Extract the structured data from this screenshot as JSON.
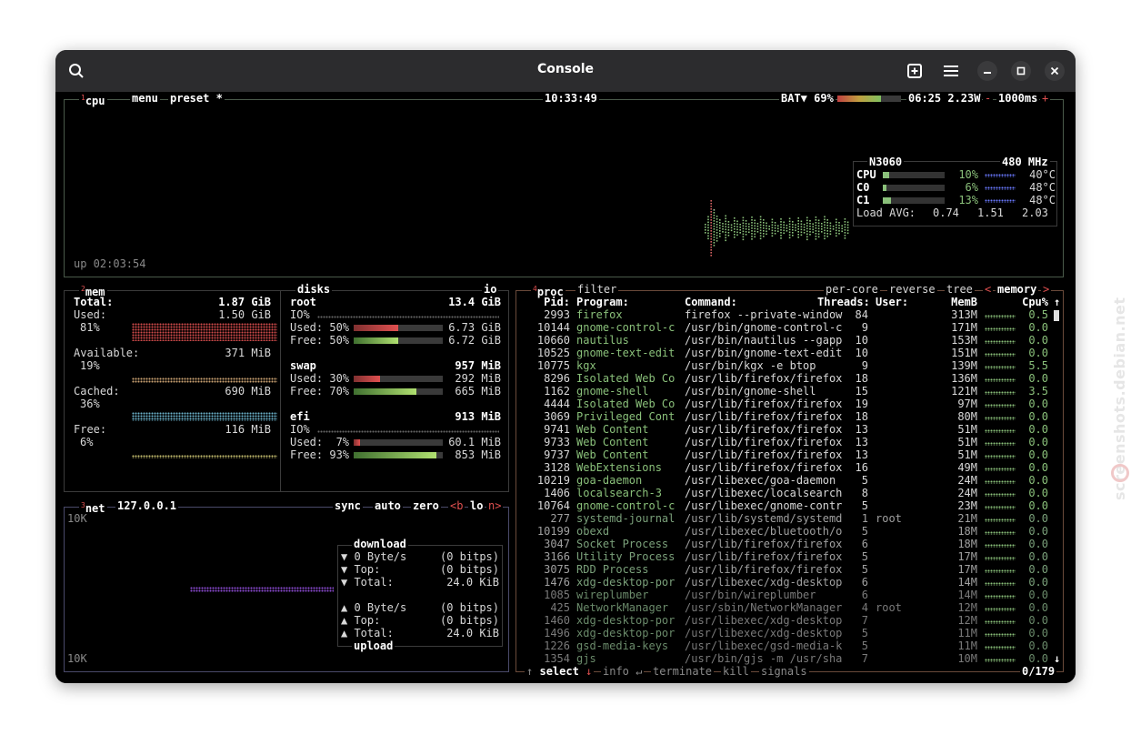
{
  "window": {
    "title": "Console"
  },
  "watermark": "screenshots.debian.net",
  "header_icons": [
    "search-icon",
    "new-tab-icon",
    "menu-icon",
    "minimize-icon",
    "maximize-icon",
    "close-icon"
  ],
  "cpu": {
    "tab_num": "1",
    "tab": "cpu",
    "menu": "menu",
    "preset": "preset *",
    "clock": "10:33:49",
    "battery": "BAT▼ 69%",
    "battery_pct": 69,
    "battery_time": "06:25 2.23W",
    "minus": "-",
    "interval": "1000ms",
    "plus": "+",
    "uptime": "up 02:03:54",
    "model": "N3060",
    "freq": "480 MHz",
    "rows": [
      {
        "label": "CPU",
        "pct": "10%",
        "value": 10,
        "temp": "40°C"
      },
      {
        "label": "C0",
        "pct": "6%",
        "value": 6,
        "temp": "48°C"
      },
      {
        "label": "C1",
        "pct": "13%",
        "value": 13,
        "temp": "48°C"
      }
    ],
    "load_label": "Load AVG:",
    "load": [
      "0.74",
      "1.51",
      "2.03"
    ]
  },
  "mem": {
    "tab_num": "2",
    "tab": "mem",
    "total_label": "Total:",
    "total": "1.87 GiB",
    "used_label": "Used:",
    "used": "1.50 GiB",
    "used_pct": "81%",
    "available_label": "Available:",
    "available": "371 MiB",
    "available_pct": "19%",
    "cached_label": "Cached:",
    "cached": "690 MiB",
    "cached_pct": "36%",
    "free_label": "Free:",
    "free": "116 MiB",
    "free_pct": "6%"
  },
  "disks": {
    "tab": "disks",
    "io": "io",
    "items": [
      {
        "name": "root",
        "size": "13.4 GiB",
        "io": "IO%",
        "used_label": "Used: 50%",
        "used": "6.73 GiB",
        "used_value": 50,
        "free_label": "Free: 50%",
        "free": "6.72 GiB",
        "free_value": 50
      },
      {
        "name": "swap",
        "size": "957 MiB",
        "used_label": "Used: 30%",
        "used": "292 MiB",
        "used_value": 30,
        "free_label": "Free: 70%",
        "free": "665 MiB",
        "free_value": 70
      },
      {
        "name": "efi",
        "size": "913 MiB",
        "io": "IO%",
        "used_label": "Used:  7%",
        "used": "60.1 MiB",
        "used_value": 7,
        "free_label": "Free: 93%",
        "free": "853 MiB",
        "free_value": 93
      }
    ]
  },
  "net": {
    "tab_num": "3",
    "tab": "net",
    "iface": "127.0.0.1",
    "sync": "sync",
    "auto": "auto",
    "zero": "zero",
    "b": "<b",
    "lo": "lo",
    "n": "n>",
    "scale_top": "10K",
    "scale_bottom": "10K",
    "download_title": "download",
    "upload_title": "upload",
    "download": [
      {
        "label": "▼ 0 Byte/s",
        "value": "(0 bitps)"
      },
      {
        "label": "▼ Top:",
        "value": "(0 bitps)"
      },
      {
        "label": "▼ Total:",
        "value": "24.0 KiB"
      }
    ],
    "upload": [
      {
        "label": "▲ 0 Byte/s",
        "value": "(0 bitps)"
      },
      {
        "label": "▲ Top:",
        "value": "(0 bitps)"
      },
      {
        "label": "▲ Total:",
        "value": "24.0 KiB"
      }
    ]
  },
  "proc": {
    "tab_num": "4",
    "tab": "proc",
    "filter": "filter",
    "per_core": "per-core",
    "reverse": "reverse",
    "tree": "tree",
    "sort_left": "<",
    "sort": "memory",
    "sort_right": ">",
    "columns": {
      "pid": "Pid:",
      "program": "Program:",
      "command": "Command:",
      "threads": "Threads:",
      "user": "User:",
      "mem": "MemB",
      "cpu": "Cpu%"
    },
    "up_arrow": "↑",
    "down_arrow": "↓",
    "rows": [
      {
        "pid": "2993",
        "program": "firefox",
        "command": "firefox --private-window",
        "threads": "84",
        "user": "",
        "mem": "313M",
        "cpu": "0.5"
      },
      {
        "pid": "10144",
        "program": "gnome-control-c",
        "command": "/usr/bin/gnome-control-c",
        "threads": "9",
        "user": "",
        "mem": "171M",
        "cpu": "0.0"
      },
      {
        "pid": "10660",
        "program": "nautilus",
        "command": "/usr/bin/nautilus --gapp",
        "threads": "10",
        "user": "",
        "mem": "153M",
        "cpu": "0.0"
      },
      {
        "pid": "10525",
        "program": "gnome-text-edit",
        "command": "/usr/bin/gnome-text-edit",
        "threads": "10",
        "user": "",
        "mem": "151M",
        "cpu": "0.0"
      },
      {
        "pid": "10775",
        "program": "kgx",
        "command": "/usr/bin/kgx -e btop",
        "threads": "9",
        "user": "",
        "mem": "139M",
        "cpu": "5.5"
      },
      {
        "pid": "8296",
        "program": "Isolated Web Co",
        "command": "/usr/lib/firefox/firefox",
        "threads": "18",
        "user": "",
        "mem": "136M",
        "cpu": "0.0"
      },
      {
        "pid": "1162",
        "program": "gnome-shell",
        "command": "/usr/bin/gnome-shell",
        "threads": "15",
        "user": "",
        "mem": "121M",
        "cpu": "3.5"
      },
      {
        "pid": "4444",
        "program": "Isolated Web Co",
        "command": "/usr/lib/firefox/firefox",
        "threads": "19",
        "user": "",
        "mem": "97M",
        "cpu": "0.0"
      },
      {
        "pid": "3069",
        "program": "Privileged Cont",
        "command": "/usr/lib/firefox/firefox",
        "threads": "18",
        "user": "",
        "mem": "80M",
        "cpu": "0.0"
      },
      {
        "pid": "9741",
        "program": "Web Content",
        "command": "/usr/lib/firefox/firefox",
        "threads": "13",
        "user": "",
        "mem": "51M",
        "cpu": "0.0"
      },
      {
        "pid": "9733",
        "program": "Web Content",
        "command": "/usr/lib/firefox/firefox",
        "threads": "13",
        "user": "",
        "mem": "51M",
        "cpu": "0.0"
      },
      {
        "pid": "9737",
        "program": "Web Content",
        "command": "/usr/lib/firefox/firefox",
        "threads": "13",
        "user": "",
        "mem": "51M",
        "cpu": "0.0"
      },
      {
        "pid": "3128",
        "program": "WebExtensions",
        "command": "/usr/lib/firefox/firefox",
        "threads": "16",
        "user": "",
        "mem": "49M",
        "cpu": "0.0"
      },
      {
        "pid": "10219",
        "program": "goa-daemon",
        "command": "/usr/libexec/goa-daemon",
        "threads": "5",
        "user": "",
        "mem": "24M",
        "cpu": "0.0"
      },
      {
        "pid": "1406",
        "program": "localsearch-3",
        "command": "/usr/libexec/localsearch",
        "threads": "8",
        "user": "",
        "mem": "24M",
        "cpu": "0.0"
      },
      {
        "pid": "10764",
        "program": "gnome-control-c",
        "command": "/usr/libexec/gnome-contr",
        "threads": "5",
        "user": "",
        "mem": "23M",
        "cpu": "0.0"
      },
      {
        "pid": "277",
        "program": "systemd-journal",
        "command": "/usr/lib/systemd/systemd",
        "threads": "1",
        "user": "root",
        "mem": "21M",
        "cpu": "0.0"
      },
      {
        "pid": "10199",
        "program": "obexd",
        "command": "/usr/libexec/bluetooth/o",
        "threads": "5",
        "user": "",
        "mem": "18M",
        "cpu": "0.0"
      },
      {
        "pid": "3047",
        "program": "Socket Process",
        "command": "/usr/lib/firefox/firefox",
        "threads": "6",
        "user": "",
        "mem": "18M",
        "cpu": "0.0"
      },
      {
        "pid": "3166",
        "program": "Utility Process",
        "command": "/usr/lib/firefox/firefox",
        "threads": "5",
        "user": "",
        "mem": "17M",
        "cpu": "0.0"
      },
      {
        "pid": "3075",
        "program": "RDD Process",
        "command": "/usr/lib/firefox/firefox",
        "threads": "5",
        "user": "",
        "mem": "17M",
        "cpu": "0.0"
      },
      {
        "pid": "1476",
        "program": "xdg-desktop-por",
        "command": "/usr/libexec/xdg-desktop",
        "threads": "6",
        "user": "",
        "mem": "14M",
        "cpu": "0.0"
      },
      {
        "pid": "1085",
        "program": "wireplumber",
        "command": "/usr/bin/wireplumber",
        "threads": "6",
        "user": "",
        "mem": "14M",
        "cpu": "0.0"
      },
      {
        "pid": "425",
        "program": "NetworkManager",
        "command": "/usr/sbin/NetworkManager",
        "threads": "4",
        "user": "root",
        "mem": "12M",
        "cpu": "0.0"
      },
      {
        "pid": "1460",
        "program": "xdg-desktop-por",
        "command": "/usr/libexec/xdg-desktop",
        "threads": "7",
        "user": "",
        "mem": "12M",
        "cpu": "0.0"
      },
      {
        "pid": "1496",
        "program": "xdg-desktop-por",
        "command": "/usr/libexec/xdg-desktop",
        "threads": "5",
        "user": "",
        "mem": "11M",
        "cpu": "0.0"
      },
      {
        "pid": "1226",
        "program": "gsd-media-keys",
        "command": "/usr/libexec/gsd-media-k",
        "threads": "5",
        "user": "",
        "mem": "11M",
        "cpu": "0.0"
      },
      {
        "pid": "1354",
        "program": "gjs",
        "command": "/usr/bin/gjs -m /usr/sha",
        "threads": "7",
        "user": "",
        "mem": "10M",
        "cpu": "0.0"
      }
    ],
    "footer": {
      "select_arrows": "↑",
      "select": "select",
      "select_down": "↓",
      "info": "info",
      "info_key": "↵",
      "terminate": "terminate",
      "kill": "kill",
      "signals": "signals",
      "count": "0/179"
    }
  },
  "colors": {
    "bg": "#000000",
    "green": "#8ac07a",
    "red": "#e05050",
    "blue": "#6a7aff",
    "cpu_border": "#4a5a4a",
    "net_border": "#4a4a6a",
    "proc_border": "#6a4a3a"
  }
}
